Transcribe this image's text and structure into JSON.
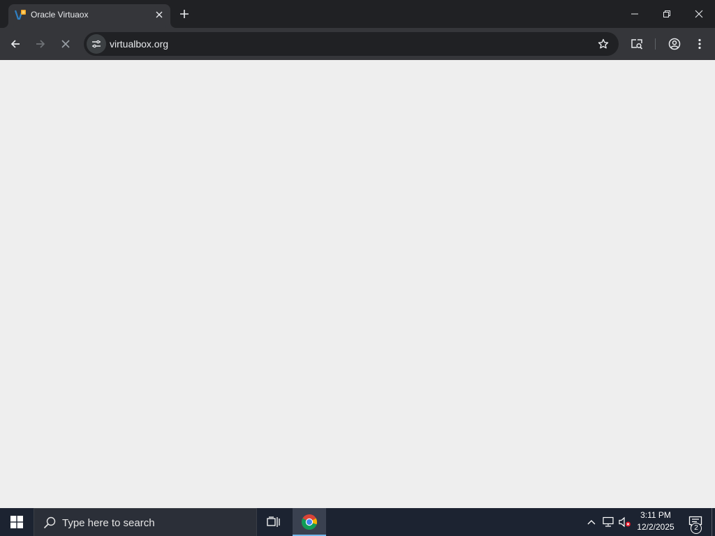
{
  "browser": {
    "tab": {
      "title": "Oracle Virtuaox",
      "favicon": "virtualbox-icon"
    },
    "new_tab_icon": "plus-icon",
    "window_controls": [
      "minimize-icon",
      "restore-icon",
      "close-icon"
    ],
    "toolbar": {
      "back_icon": "arrow-left-icon",
      "forward_icon": "arrow-right-icon",
      "stop_icon": "x-icon",
      "site_info_icon": "tune-icon",
      "url": "virtualbox.org",
      "bookmark_icon": "star-icon",
      "lens_icon": "search-page-icon",
      "profile_icon": "account-circle-icon",
      "menu_icon": "dots-vertical-icon"
    }
  },
  "page": {
    "background": "#eeeeee"
  },
  "taskbar": {
    "start_icon": "windows-logo-icon",
    "search_placeholder": "Type here to search",
    "taskview_icon": "task-view-icon",
    "pinned_app": "chrome-icon",
    "tray": {
      "chevron_icon": "chevron-up-icon",
      "network_icon": "network-icon",
      "volume_icon": "volume-muted-icon"
    },
    "clock": {
      "time": "3:11 PM",
      "date": "12/2/2025"
    },
    "notifications": {
      "icon": "action-center-icon",
      "count": "2"
    }
  },
  "colors": {
    "tabstrip": "#202124",
    "toolbar": "#35363a",
    "omnibox": "#202124",
    "taskbar": "#1c2331",
    "accent": "#76b9ed"
  }
}
